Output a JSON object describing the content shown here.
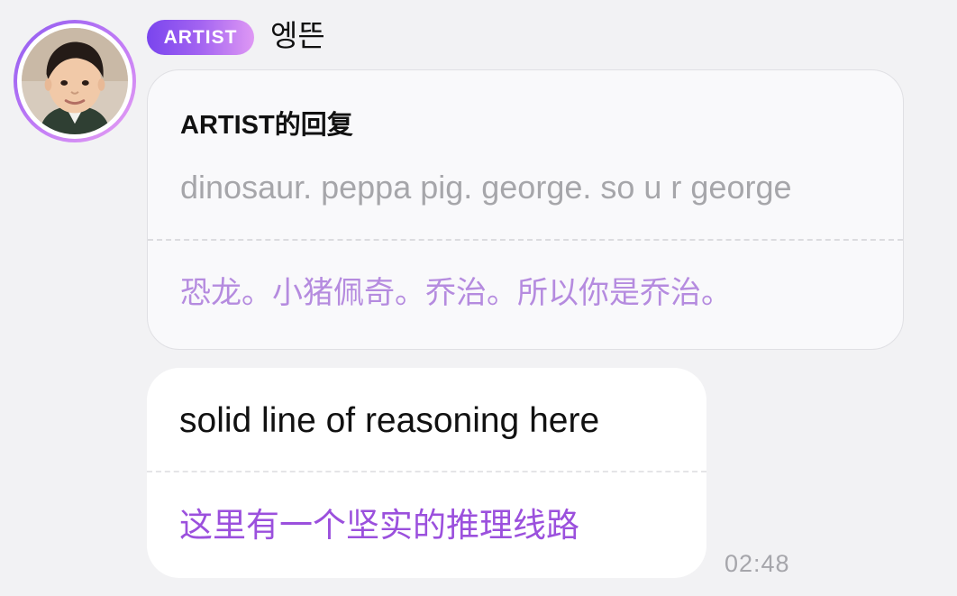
{
  "sender": {
    "badge": "ARTIST",
    "name": "엥뜬",
    "avatar_icon": "avatar-photo",
    "accent_color": "#8f5bf0"
  },
  "reply": {
    "title": "ARTIST的回复",
    "text": "dinosaur. peppa pig. george. so u r george",
    "translation": "恐龙。小猪佩奇。乔治。所以你是乔治。"
  },
  "message": {
    "text": "solid line of reasoning here",
    "translation": "这里有一个坚实的推理线路",
    "timestamp": "02:48",
    "translation_color": "#9b50dd"
  }
}
